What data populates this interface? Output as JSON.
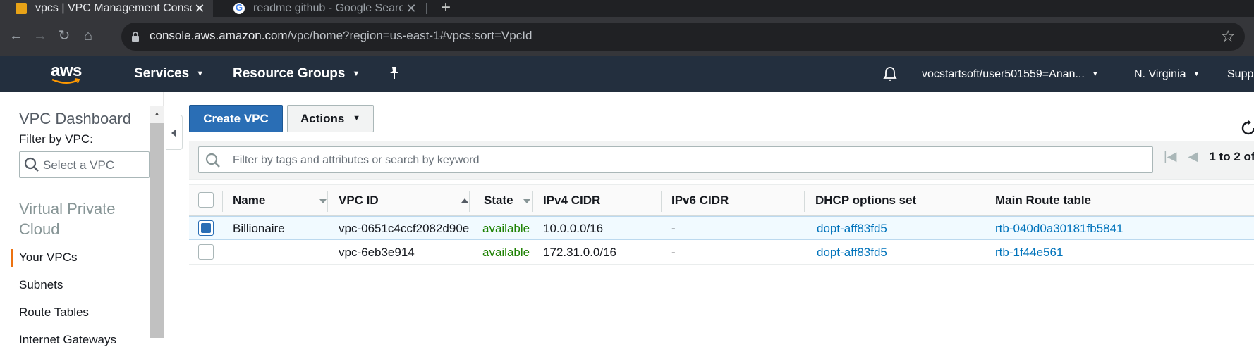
{
  "browser": {
    "tabs": [
      {
        "title": "vpcs | VPC Management Console",
        "active": true
      },
      {
        "title": "readme github - Google Search",
        "active": false
      }
    ],
    "url_host": "console.aws.amazon.com",
    "url_path": "/vpc/home?region=us-east-1#vpcs:sort=VpcId"
  },
  "header": {
    "logo": "aws",
    "nav": [
      {
        "label": "Services"
      },
      {
        "label": "Resource Groups"
      }
    ],
    "account": "vocstartsoft/user501559=Anan...",
    "region": "N. Virginia",
    "support": "Supp"
  },
  "sidebar": {
    "title": "VPC Dashboard",
    "filter_label": "Filter by VPC:",
    "filter_placeholder": "Select a VPC",
    "section": "Virtual Private Cloud",
    "items": [
      {
        "label": "Your VPCs",
        "active": true
      },
      {
        "label": "Subnets",
        "active": false
      },
      {
        "label": "Route Tables",
        "active": false
      },
      {
        "label": "Internet Gateways",
        "active": false
      }
    ]
  },
  "toolbar": {
    "create_label": "Create VPC",
    "actions_label": "Actions"
  },
  "search": {
    "placeholder": "Filter by tags and attributes or search by keyword",
    "pager_text": "1 to 2 of"
  },
  "table": {
    "columns": [
      "Name",
      "VPC ID",
      "State",
      "IPv4 CIDR",
      "IPv6 CIDR",
      "DHCP options set",
      "Main Route table"
    ],
    "rows": [
      {
        "selected": true,
        "name": "Billionaire",
        "vpc_id": "vpc-0651c4ccf2082d90e",
        "state": "available",
        "ipv4": "10.0.0.0/16",
        "ipv6": "-",
        "dhcp": "dopt-aff83fd5",
        "route": "rtb-040d0a30181fb5841"
      },
      {
        "selected": false,
        "name": "",
        "vpc_id": "vpc-6eb3e914",
        "state": "available",
        "ipv4": "172.31.0.0/16",
        "ipv6": "-",
        "dhcp": "dopt-aff83fd5",
        "route": "rtb-1f44e561"
      }
    ]
  },
  "colors": {
    "aws_header": "#232f3e",
    "primary_button": "#2a6eb5",
    "status_available": "#1d8102",
    "link": "#0073bb",
    "active_nav_marker": "#ec7211"
  }
}
